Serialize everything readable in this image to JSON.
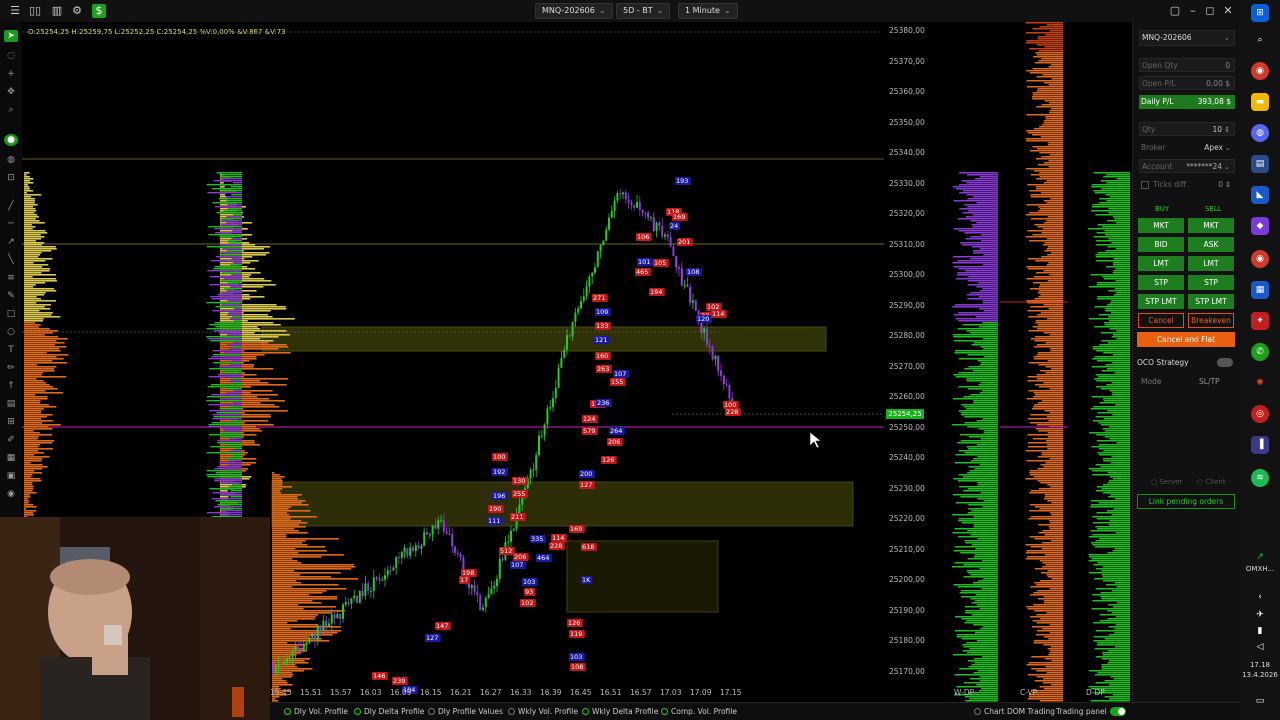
{
  "topbar": {
    "instrument": "MNQ-202606",
    "dataseries": "5D - BT",
    "timeframe": "1 Minute"
  },
  "chart": {
    "ohlc_text": "O:25254,25  H:25259,75  L:25252,25  C:25254,25  %V:0,00%  &V:867  &V:73",
    "price_labels": [
      "25380,00",
      "25370,00",
      "25360,00",
      "25350,00",
      "25340,00",
      "25330,00",
      "25320,00",
      "25310,00",
      "25300,00",
      "25290,00",
      "25280,00",
      "25270,00",
      "25260,00",
      "25250,00",
      "25240,00",
      "25230,00",
      "25220,00",
      "25210,00",
      "25200,00",
      "25190,00",
      "25180,00",
      "25170,00"
    ],
    "current_price": "25254,25",
    "time_labels": [
      "15.45",
      "15.51",
      "15.57",
      "16.03",
      "16.09",
      "16.15",
      "16.21",
      "16.27",
      "16.33",
      "16.39",
      "16.45",
      "16.51",
      "16.57",
      "17.03",
      "17.09",
      "17.15"
    ],
    "profile_labels": [
      "W-DP",
      "C-VP",
      "D-DP"
    ],
    "trade_labels": [
      "193",
      "118",
      "169",
      "24",
      "106",
      "201",
      "101",
      "465",
      "105",
      "108",
      "194",
      "271",
      "109",
      "102",
      "23",
      "120",
      "114",
      "133",
      "121",
      "160",
      "263",
      "107",
      "155",
      "115",
      "236",
      "124",
      "579",
      "264",
      "206",
      "126",
      "200",
      "127",
      "100",
      "192",
      "130",
      "255",
      "196",
      "190",
      "211",
      "111",
      "169",
      "618",
      "335",
      "512",
      "206",
      "107",
      "114",
      "228",
      "464",
      "198",
      "17",
      "103",
      "93",
      "102",
      "1K",
      "126",
      "119",
      "103",
      "108",
      "147",
      "127",
      "146",
      "239",
      "104",
      "100",
      "228"
    ]
  },
  "bottombar": {
    "items": [
      "Dly Vol. Profile",
      "Dly Delta Profile",
      "Dly Profile Values",
      "Wkly Vol. Profile",
      "Wkly Delta Profile",
      "Comp. Vol. Profile"
    ],
    "chart_dom": "Chart DOM Trading",
    "trading_panel": "Trading panel"
  },
  "panel": {
    "instrument": "MNQ-202606",
    "open_qty_label": "Open Qty",
    "open_qty_value": "0",
    "open_pl_label": "Open P/L",
    "open_pl_value": "0,00 $",
    "daily_pl_label": "Daily P/L",
    "daily_pl_value": "393,08 $",
    "qty_label": "Qty",
    "qty_value": "10",
    "broker_label": "Broker",
    "broker_value": "Apex",
    "account_label": "Account",
    "account_value": "*******24",
    "ticks_diff_label": "Ticks diff.",
    "ticks_diff_value": "0",
    "buy_label": "BUY",
    "sell_label": "SELL",
    "buttons": [
      "MKT",
      "BID",
      "LMT",
      "STP",
      "STP LMT"
    ],
    "sell_buttons": [
      "MKT",
      "ASK",
      "LMT",
      "STP",
      "STP LMT"
    ],
    "cancel": "Cancel",
    "breakeven": "Breakeven",
    "cancel_flat": "Cancel and Flat",
    "oco_label": "OCO Strategy",
    "mode_label": "Mode",
    "mode_value": "SL/TP",
    "server_label": "Server",
    "client_label": "Client",
    "link_orders": "Link pending orders"
  },
  "winbar": {
    "omx_label": "OMXH...",
    "time": "17.18",
    "date": "13.4.2026"
  },
  "colors": {
    "bull": "#22cc22",
    "bear": "#e02020",
    "profile_orange": "#e06a1a",
    "profile_yellow": "#d8c850",
    "profile_green": "#1fbf1f",
    "profile_purple": "#8a3ad8",
    "zone": "#5a5a10",
    "magenta_line": "#d020c0"
  }
}
